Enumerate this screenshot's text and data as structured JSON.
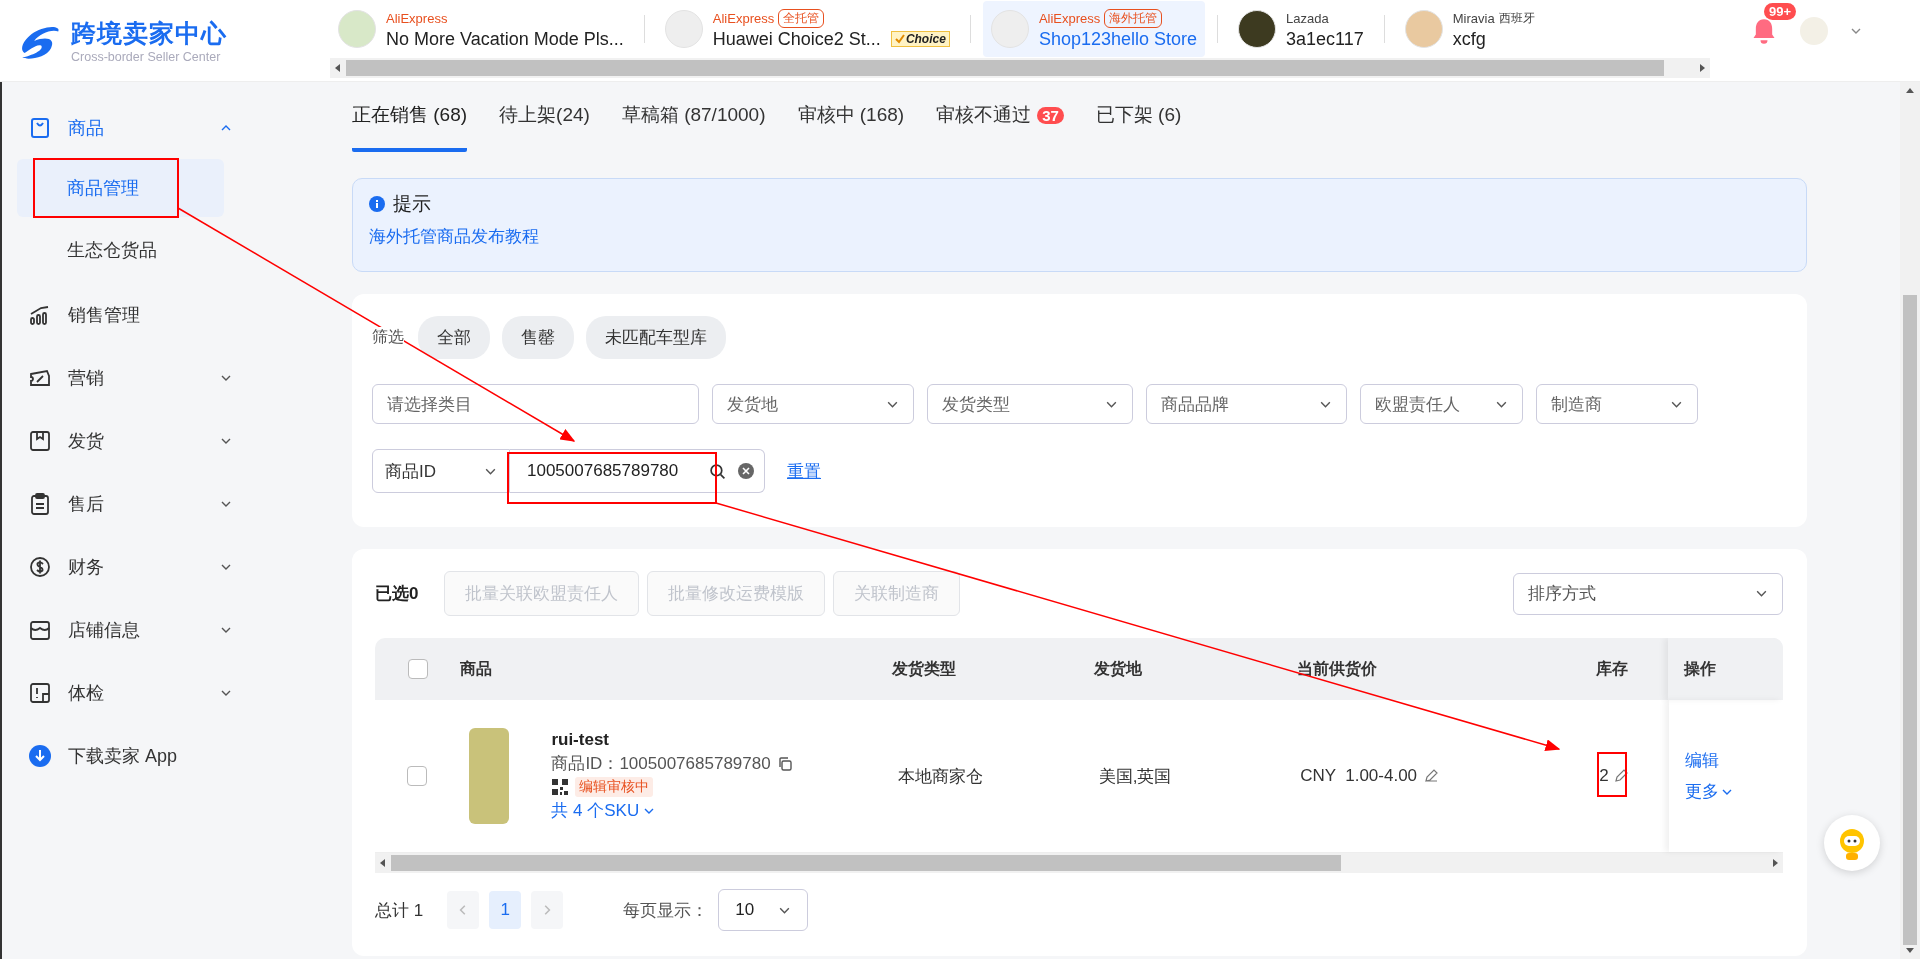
{
  "header": {
    "logo_title": "跨境卖家中心",
    "logo_subtitle": "Cross-border Seller Center",
    "stores": [
      {
        "platform": "AliExpress",
        "name": "No More Vacation Mode Pls...",
        "selected": false
      },
      {
        "platform": "AliExpress",
        "badge": "全托管",
        "name": "Huawei Choice2 St...",
        "choice": "Choice",
        "selected": false
      },
      {
        "platform": "AliExpress",
        "badge": "海外托管",
        "name": "Shop123hello Store",
        "selected": true
      },
      {
        "platform": "Lazada",
        "name": "3a1ec117",
        "selected": false
      },
      {
        "platform": "Miravia",
        "region": "西班牙",
        "name": "xcfg",
        "selected": false
      }
    ],
    "notifications": "99+"
  },
  "sidebar": {
    "items": [
      {
        "label": "商品",
        "kind": "group",
        "expanded": true,
        "children": [
          {
            "label": "商品管理",
            "selected": true
          },
          {
            "label": "生态仓货品",
            "selected": false
          }
        ]
      },
      {
        "label": "销售管理",
        "kind": "link"
      },
      {
        "label": "营销",
        "kind": "group",
        "expanded": false
      },
      {
        "label": "发货",
        "kind": "group",
        "expanded": false
      },
      {
        "label": "售后",
        "kind": "group",
        "expanded": false
      },
      {
        "label": "财务",
        "kind": "group",
        "expanded": false
      },
      {
        "label": "店铺信息",
        "kind": "group",
        "expanded": false
      },
      {
        "label": "体检",
        "kind": "group",
        "expanded": false
      },
      {
        "label": "下载卖家 App",
        "kind": "download"
      }
    ]
  },
  "tabs": [
    {
      "label": "正在销售 (68)",
      "selected": true
    },
    {
      "label": "待上架(24)",
      "selected": false
    },
    {
      "label": "草稿箱 (87/1000)",
      "selected": false
    },
    {
      "label": "审核中 (168)",
      "selected": false
    },
    {
      "label": "审核不通过",
      "badge": "37",
      "selected": false
    },
    {
      "label": "已下架 (6)",
      "selected": false
    }
  ],
  "notice": {
    "title": "提示",
    "link": "海外托管商品发布教程"
  },
  "filters": {
    "label": "筛选",
    "chips": [
      "全部",
      "售罄",
      "未匹配车型库"
    ],
    "fields": [
      {
        "placeholder": "请选择类目",
        "kind": "input"
      },
      {
        "placeholder": "发货地",
        "kind": "select"
      },
      {
        "placeholder": "发货类型",
        "kind": "select"
      },
      {
        "placeholder": "商品品牌",
        "kind": "select"
      },
      {
        "placeholder": "欧盟责任人",
        "kind": "select"
      },
      {
        "placeholder": "制造商",
        "kind": "select"
      }
    ],
    "search": {
      "field": "商品ID",
      "value": "1005007685789780"
    },
    "reset": "重置"
  },
  "toolbar": {
    "selected_count": "已选0",
    "actions": [
      {
        "label": "批量关联欧盟责任人",
        "disabled": true
      },
      {
        "label": "批量修改运费模版",
        "disabled": true
      },
      {
        "label": "关联制造商",
        "disabled": true
      }
    ],
    "sort": {
      "placeholder": "排序方式"
    }
  },
  "table": {
    "select_all_checked": false,
    "columns": [
      "商品",
      "发货类型",
      "发货地",
      "当前供货价",
      "库存",
      "操作"
    ],
    "rows": [
      {
        "checked": false,
        "title": "rui-test",
        "product_id": "商品ID：1005007685789780",
        "status": "编辑审核中",
        "sku": "共 4 个SKU",
        "ship_type": "本地商家仓",
        "ship_from": "美国,英国",
        "price": "CNY  1.00-4.00",
        "stock": "2",
        "actions": [
          "编辑",
          "更多"
        ]
      }
    ]
  },
  "pagination": {
    "total": "总计 1",
    "pages": [
      {
        "label": "1",
        "selected": true
      }
    ],
    "page_size_label": "每页显示：",
    "page_size": "10"
  }
}
